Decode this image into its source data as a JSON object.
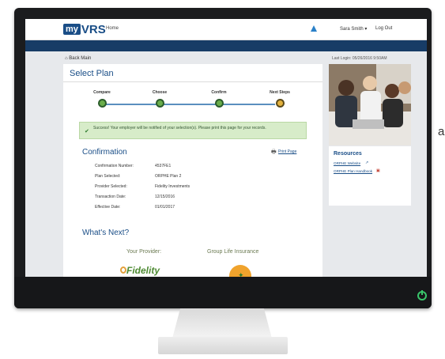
{
  "app": {
    "logo_my": "my",
    "logo_vrs": "VRS",
    "nav_home": "Home",
    "user": "Sara Smith ▾",
    "logout": "Log Out"
  },
  "breadcrumb": "Back Main",
  "last_login": "Last Login: 05/26/2016 9:50AM",
  "page": {
    "title": "Select Plan",
    "steps": [
      {
        "label": "Compare",
        "state": "complete"
      },
      {
        "label": "Choose",
        "state": "complete"
      },
      {
        "label": "Confirm",
        "state": "complete"
      },
      {
        "label": "Next Steps",
        "state": "current"
      }
    ],
    "success_message": "Success! Your employer will be notified of your selection(s). Please print this page for your records.",
    "confirmation_title": "Confirmation",
    "print_label": "Print Page",
    "details": [
      {
        "key": "Confirmation Number:",
        "value": "4537FE1"
      },
      {
        "key": "Plan Selected:",
        "value": "ORPHE Plan 2"
      },
      {
        "key": "Provider Selected:",
        "value": "Fidelity Investments"
      },
      {
        "key": "Transaction Date:",
        "value": "12/15/2016"
      },
      {
        "key": "Effective Date:",
        "value": "01/01/2017"
      }
    ],
    "whats_next_title": "What's Next?",
    "provider_heading": "Your Provider:",
    "insurance_heading": "Group Life Insurance",
    "provider_logo_text": "Fidelity"
  },
  "resources": {
    "title": "Resources",
    "links": [
      {
        "label": "ORPHE Website",
        "icon": "external-link-icon"
      },
      {
        "label": "ORPHE Plan Handbook",
        "icon": "pdf-icon"
      }
    ]
  },
  "peek_text": "a",
  "colors": {
    "brand_blue": "#1a4e87",
    "nav_bar": "#173c66",
    "step_complete": "#6aad4b",
    "step_current": "#e3b13d",
    "success_bg": "#d7ecc9"
  }
}
